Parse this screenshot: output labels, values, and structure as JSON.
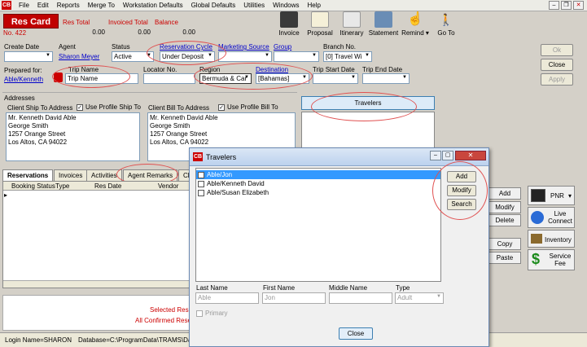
{
  "menu": {
    "items": [
      "File",
      "Edit",
      "Reports",
      "Merge To",
      "Workstation Defaults",
      "Global Defaults",
      "Utilities",
      "Windows",
      "Help"
    ],
    "logo": "CB"
  },
  "header": {
    "title": "Res Card",
    "number": "No. 422",
    "res_total_label": "Res Total",
    "res_total": "0.00",
    "invoiced_total_label": "Invoiced Total",
    "invoiced_total": "0.00",
    "balance_label": "Balance",
    "balance": "0.00"
  },
  "toolbar": {
    "invoice": "Invoice",
    "proposal": "Proposal",
    "itinerary": "Itinerary",
    "statement": "Statement",
    "remind": "Remind",
    "goto": "Go To"
  },
  "form": {
    "create_date_label": "Create Date",
    "create_date": "",
    "agent_label": "Agent",
    "agent": "Sharon Meyer",
    "status_label": "Status",
    "status": "Active",
    "res_cycle_label": "Reservation Cycle",
    "res_cycle": "Under Deposit",
    "marketing_label": "Marketing Source",
    "marketing": "",
    "group_label": "Group",
    "group": "",
    "branch_label": "Branch No.",
    "branch": "[0] Travel Wi",
    "prepared_label": "Prepared for:",
    "prepared": "Able/Kenneth",
    "trip_name_label": "Trip Name",
    "trip_name": "Trip Name",
    "locator_label": "Locator No.",
    "locator": "",
    "region_label": "Region",
    "region": "Bermuda & Car",
    "destination_label": "Destination",
    "destination": "[Bahamas]",
    "trip_start_label": "Trip Start Date",
    "trip_start": "",
    "trip_end_label": "Trip End Date",
    "trip_end": ""
  },
  "buttons": {
    "ok": "Ok",
    "close": "Close",
    "apply": "Apply",
    "travelers": "Travelers"
  },
  "addresses": {
    "title": "Addresses",
    "ship_label": "Client Ship To Address",
    "use_ship": "Use Profile Ship To",
    "ship_lines": [
      "Mr. Kenneth David Able",
      "George Smith",
      "1257 Orange Street",
      "Los Altos, CA 94022"
    ],
    "bill_label": "Client Bill To Address",
    "use_bill": "Use Profile Bill To",
    "bill_lines": [
      "Mr. Kenneth David Able",
      "George Smith",
      "1257 Orange Street",
      "Los Altos, CA 94022"
    ]
  },
  "tabs": {
    "reservations": "Reservations",
    "invoices": "Invoices",
    "activities": "Activities",
    "agent_remarks": "Agent Remarks",
    "more": "Cl"
  },
  "grid": {
    "columns": [
      "Booking Status",
      "Type",
      "Res Date",
      "Vendor"
    ]
  },
  "bottom": {
    "selected": "Selected Rese",
    "all_confirmed": "All Confirmed Reser"
  },
  "side": {
    "add": "Add",
    "modify": "Modify",
    "delete": "Delete",
    "copy": "Copy",
    "paste": "Paste",
    "pnr": "PNR",
    "live_connect": "Live Connect",
    "inventory": "Inventory",
    "service_fee": "Service Fee"
  },
  "status_bar": {
    "login": "Login Name=SHARON",
    "database": "Database=C:\\ProgramData\\TRAMS\\Dat"
  },
  "dialog": {
    "title": "Travelers",
    "travelers": [
      "Able/Jon",
      "Able/Kenneth David",
      "Able/Susan Elizabeth"
    ],
    "add": "Add",
    "modify": "Modify",
    "search": "Search",
    "last_name_label": "Last Name",
    "last_name": "Able",
    "first_name_label": "First Name",
    "first_name": "Jon",
    "middle_name_label": "Middle Name",
    "middle_name": "",
    "type_label": "Type",
    "type": "Adult",
    "primary": "Primary",
    "close": "Close"
  }
}
